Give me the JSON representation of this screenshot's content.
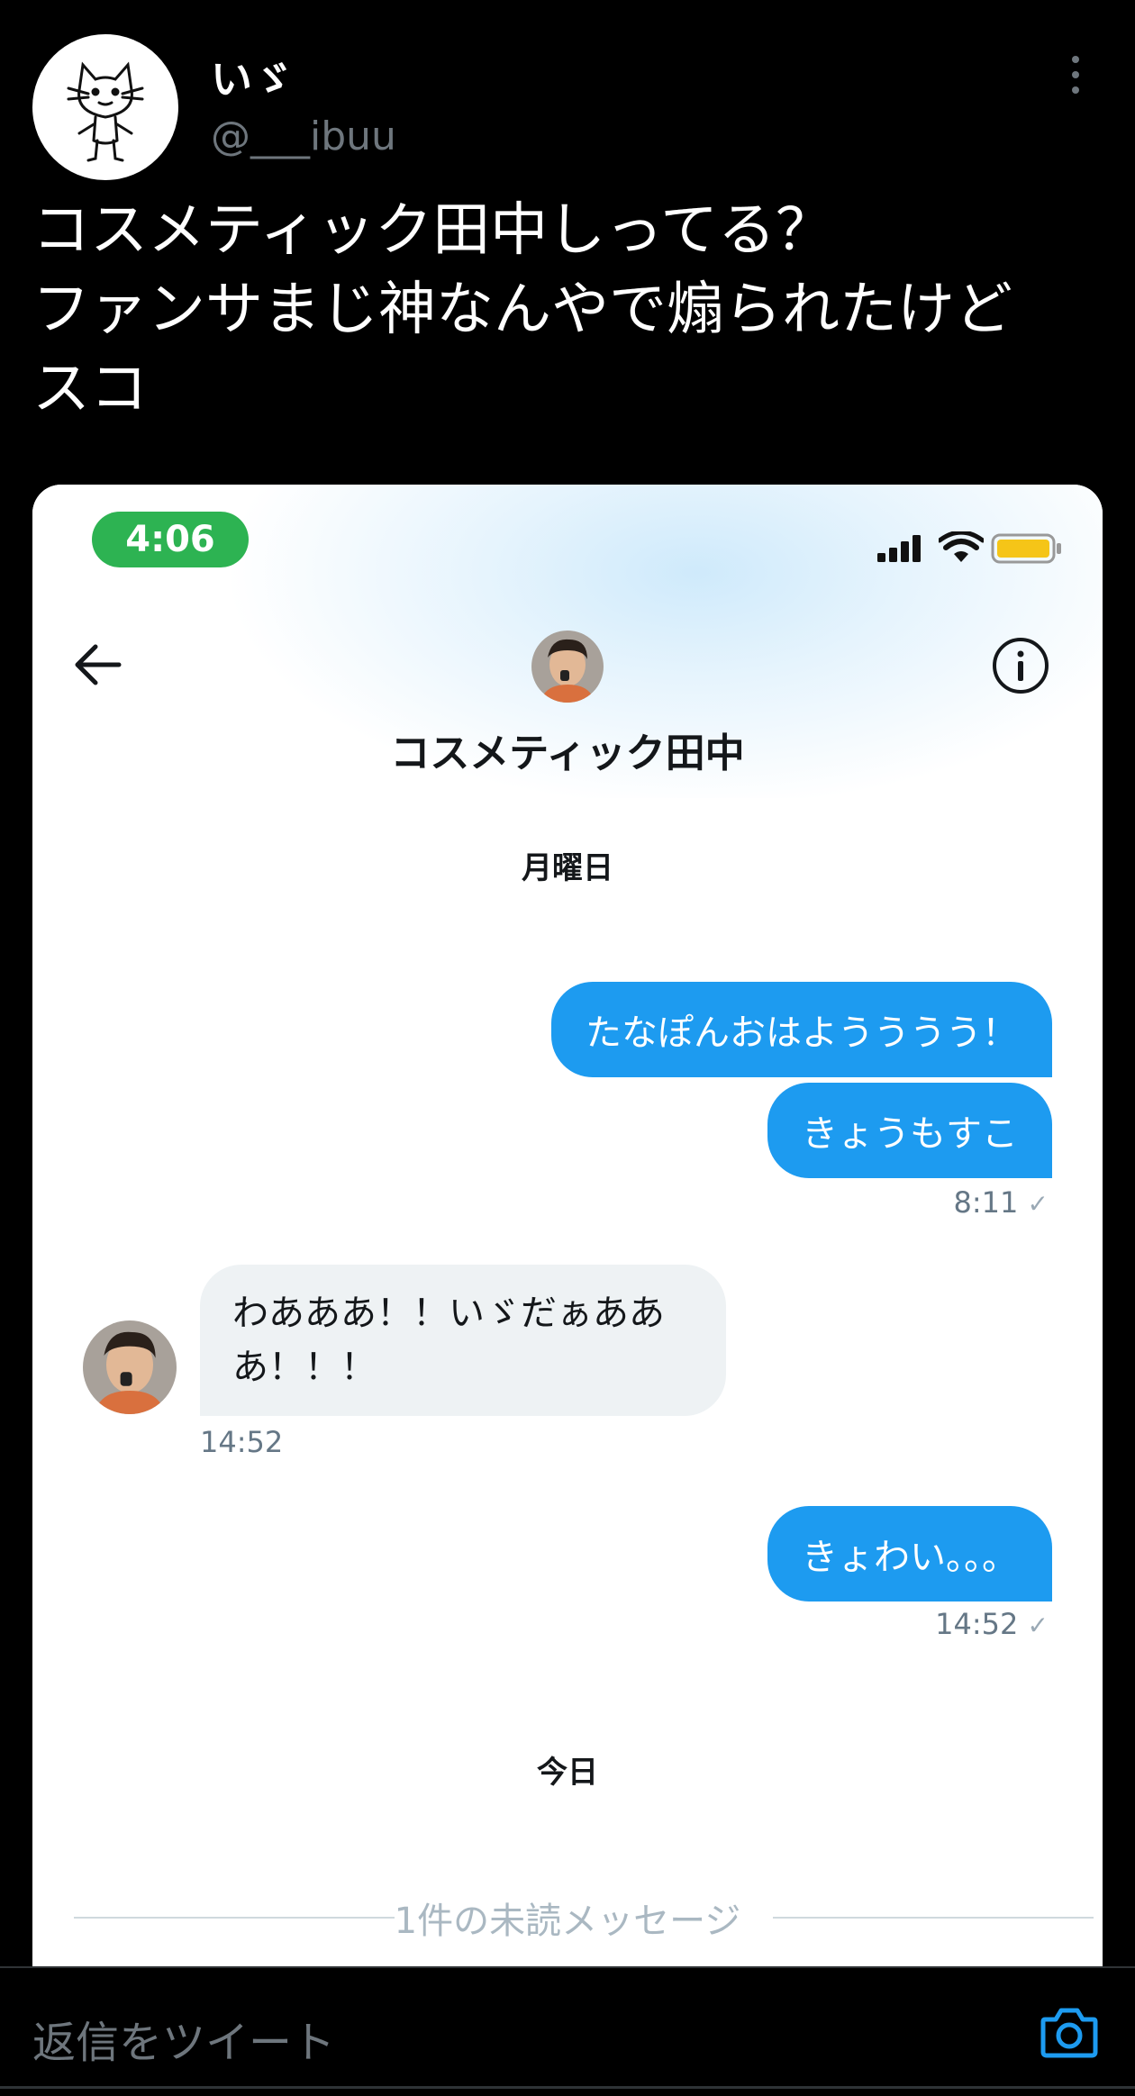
{
  "tweet": {
    "author_name": "いゞ",
    "author_handle": "@___ibuu",
    "text": "コスメティック田中しってる？\nファンサまじ神なんやで煽られたけど\nスコ"
  },
  "screenshot": {
    "status_time": "4:06",
    "contact_name": "コスメティック田中",
    "day_label_1": "月曜日",
    "messages": [
      {
        "text": "たなぽんおはようううう！"
      },
      {
        "text": "きょうもすこ"
      },
      {
        "time": "8:11"
      },
      {
        "text": "わあああ！！いゞだぁあああ！！！",
        "line1": "わあああ！！いゞだぁああ",
        "line2": "あ！！！",
        "time": "14:52"
      },
      {
        "text": "きょわい。。。",
        "time": "14:52"
      }
    ],
    "day_label_2": "今日",
    "unread_divider": "1件の未読メッセージ"
  },
  "reply": {
    "placeholder": "返信をツイート"
  },
  "colors": {
    "accent": "#1d9bf0",
    "status_pill": "#2db352",
    "battery": "#f5c518"
  },
  "icons": [
    "more-vertical-icon",
    "signal-icon",
    "wifi-icon",
    "battery-icon",
    "back-arrow-icon",
    "info-icon",
    "camera-icon"
  ]
}
